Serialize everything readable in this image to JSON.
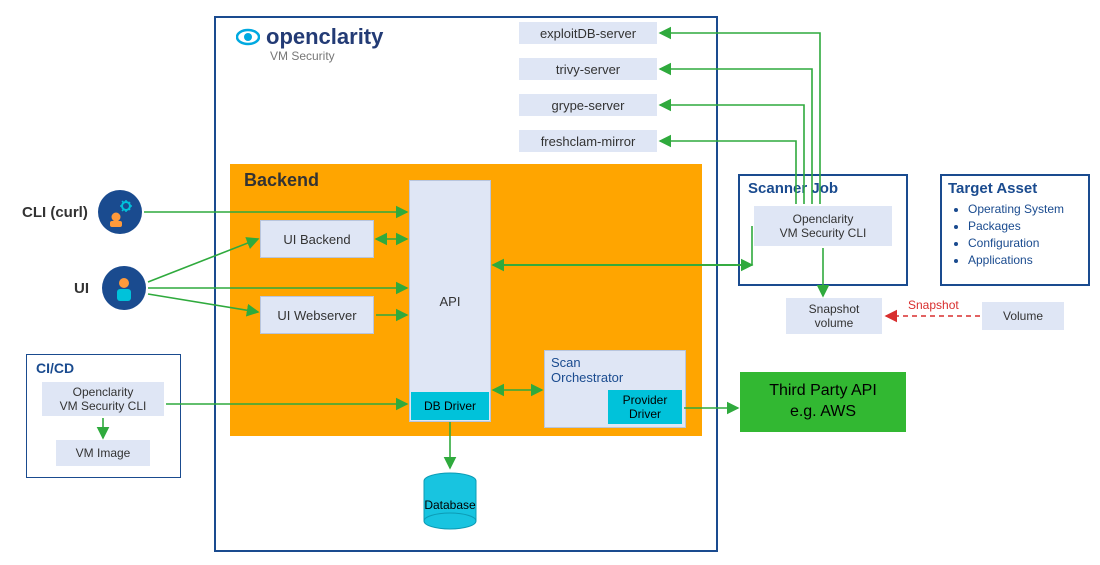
{
  "brand": {
    "name": "openclarity",
    "subtitle": "VM Security"
  },
  "servers": [
    {
      "label": "exploitDB-server"
    },
    {
      "label": "trivy-server"
    },
    {
      "label": "grype-server"
    },
    {
      "label": "freshclam-mirror"
    }
  ],
  "backend": {
    "title": "Backend",
    "ui_backend": "UI Backend",
    "ui_webserver": "UI Webserver",
    "api": "API",
    "db_driver": "DB Driver",
    "scan_orch": {
      "title": "Scan\nOrchestrator",
      "provider_driver": "Provider\nDriver"
    },
    "database": "Database"
  },
  "external": {
    "cli_curl": "CLI (curl)",
    "ui": "UI",
    "cicd": {
      "title": "CI/CD",
      "cli": "Openclarity\nVM Security CLI",
      "vm_image": "VM Image"
    }
  },
  "scanner": {
    "title": "Scanner Job",
    "cli": "Openclarity\nVM Security CLI",
    "snapshot_volume": "Snapshot\nvolume"
  },
  "target": {
    "title": "Target Asset",
    "bullets": [
      "Operating System",
      "Packages",
      "Configuration",
      "Applications"
    ],
    "volume": "Volume"
  },
  "snapshot_label": "Snapshot",
  "third_party_api": "Third Party API\ne.g. AWS",
  "chart_data": {
    "type": "diagram",
    "nodes": [
      {
        "id": "openclarity-container",
        "label": "openclarity VM Security (main frame)"
      },
      {
        "id": "exploitDB-server"
      },
      {
        "id": "trivy-server"
      },
      {
        "id": "grype-server"
      },
      {
        "id": "freshclam-mirror"
      },
      {
        "id": "backend",
        "label": "Backend"
      },
      {
        "id": "ui-backend",
        "label": "UI Backend",
        "parent": "backend"
      },
      {
        "id": "ui-webserver",
        "label": "UI Webserver",
        "parent": "backend"
      },
      {
        "id": "api",
        "label": "API",
        "parent": "backend"
      },
      {
        "id": "db-driver",
        "label": "DB Driver",
        "parent": "api"
      },
      {
        "id": "scan-orchestrator",
        "label": "Scan Orchestrator",
        "parent": "backend"
      },
      {
        "id": "provider-driver",
        "label": "Provider Driver",
        "parent": "scan-orchestrator"
      },
      {
        "id": "database",
        "label": "Database"
      },
      {
        "id": "cli-curl",
        "label": "CLI (curl)"
      },
      {
        "id": "ui",
        "label": "UI"
      },
      {
        "id": "cicd",
        "label": "CI/CD"
      },
      {
        "id": "cicd-cli",
        "label": "Openclarity VM Security CLI",
        "parent": "cicd"
      },
      {
        "id": "cicd-vm-image",
        "label": "VM Image",
        "parent": "cicd"
      },
      {
        "id": "scanner-job",
        "label": "Scanner Job"
      },
      {
        "id": "scanner-cli",
        "label": "Openclarity VM Security CLI",
        "parent": "scanner-job"
      },
      {
        "id": "snapshot-volume",
        "label": "Snapshot volume"
      },
      {
        "id": "target-asset",
        "label": "Target Asset",
        "children": [
          "Operating System",
          "Packages",
          "Configuration",
          "Applications"
        ]
      },
      {
        "id": "volume",
        "label": "Volume"
      },
      {
        "id": "third-party-api",
        "label": "Third Party API e.g. AWS"
      }
    ],
    "edges": [
      {
        "from": "cli-curl",
        "to": "api",
        "direction": "uni"
      },
      {
        "from": "ui",
        "to": "ui-backend",
        "direction": "uni"
      },
      {
        "from": "ui",
        "to": "ui-webserver",
        "direction": "uni"
      },
      {
        "from": "ui",
        "to": "api",
        "direction": "uni"
      },
      {
        "from": "ui-backend",
        "to": "api",
        "direction": "bi"
      },
      {
        "from": "ui-webserver",
        "to": "api",
        "direction": "uni"
      },
      {
        "from": "cicd-cli",
        "to": "db-driver",
        "direction": "uni"
      },
      {
        "from": "cicd-cli",
        "to": "cicd-vm-image",
        "direction": "uni"
      },
      {
        "from": "db-driver",
        "to": "database",
        "direction": "uni"
      },
      {
        "from": "api",
        "to": "scan-orchestrator",
        "direction": "bi"
      },
      {
        "from": "api",
        "to": "scanner-cli",
        "direction": "bi"
      },
      {
        "from": "scanner-cli",
        "to": "exploitDB-server",
        "direction": "uni"
      },
      {
        "from": "scanner-cli",
        "to": "trivy-server",
        "direction": "uni"
      },
      {
        "from": "scanner-cli",
        "to": "grype-server",
        "direction": "uni"
      },
      {
        "from": "scanner-cli",
        "to": "freshclam-mirror",
        "direction": "uni"
      },
      {
        "from": "scanner-cli",
        "to": "snapshot-volume",
        "direction": "uni"
      },
      {
        "from": "volume",
        "to": "snapshot-volume",
        "direction": "uni",
        "label": "Snapshot",
        "style": "dashed-red"
      },
      {
        "from": "provider-driver",
        "to": "third-party-api",
        "direction": "uni"
      }
    ]
  }
}
